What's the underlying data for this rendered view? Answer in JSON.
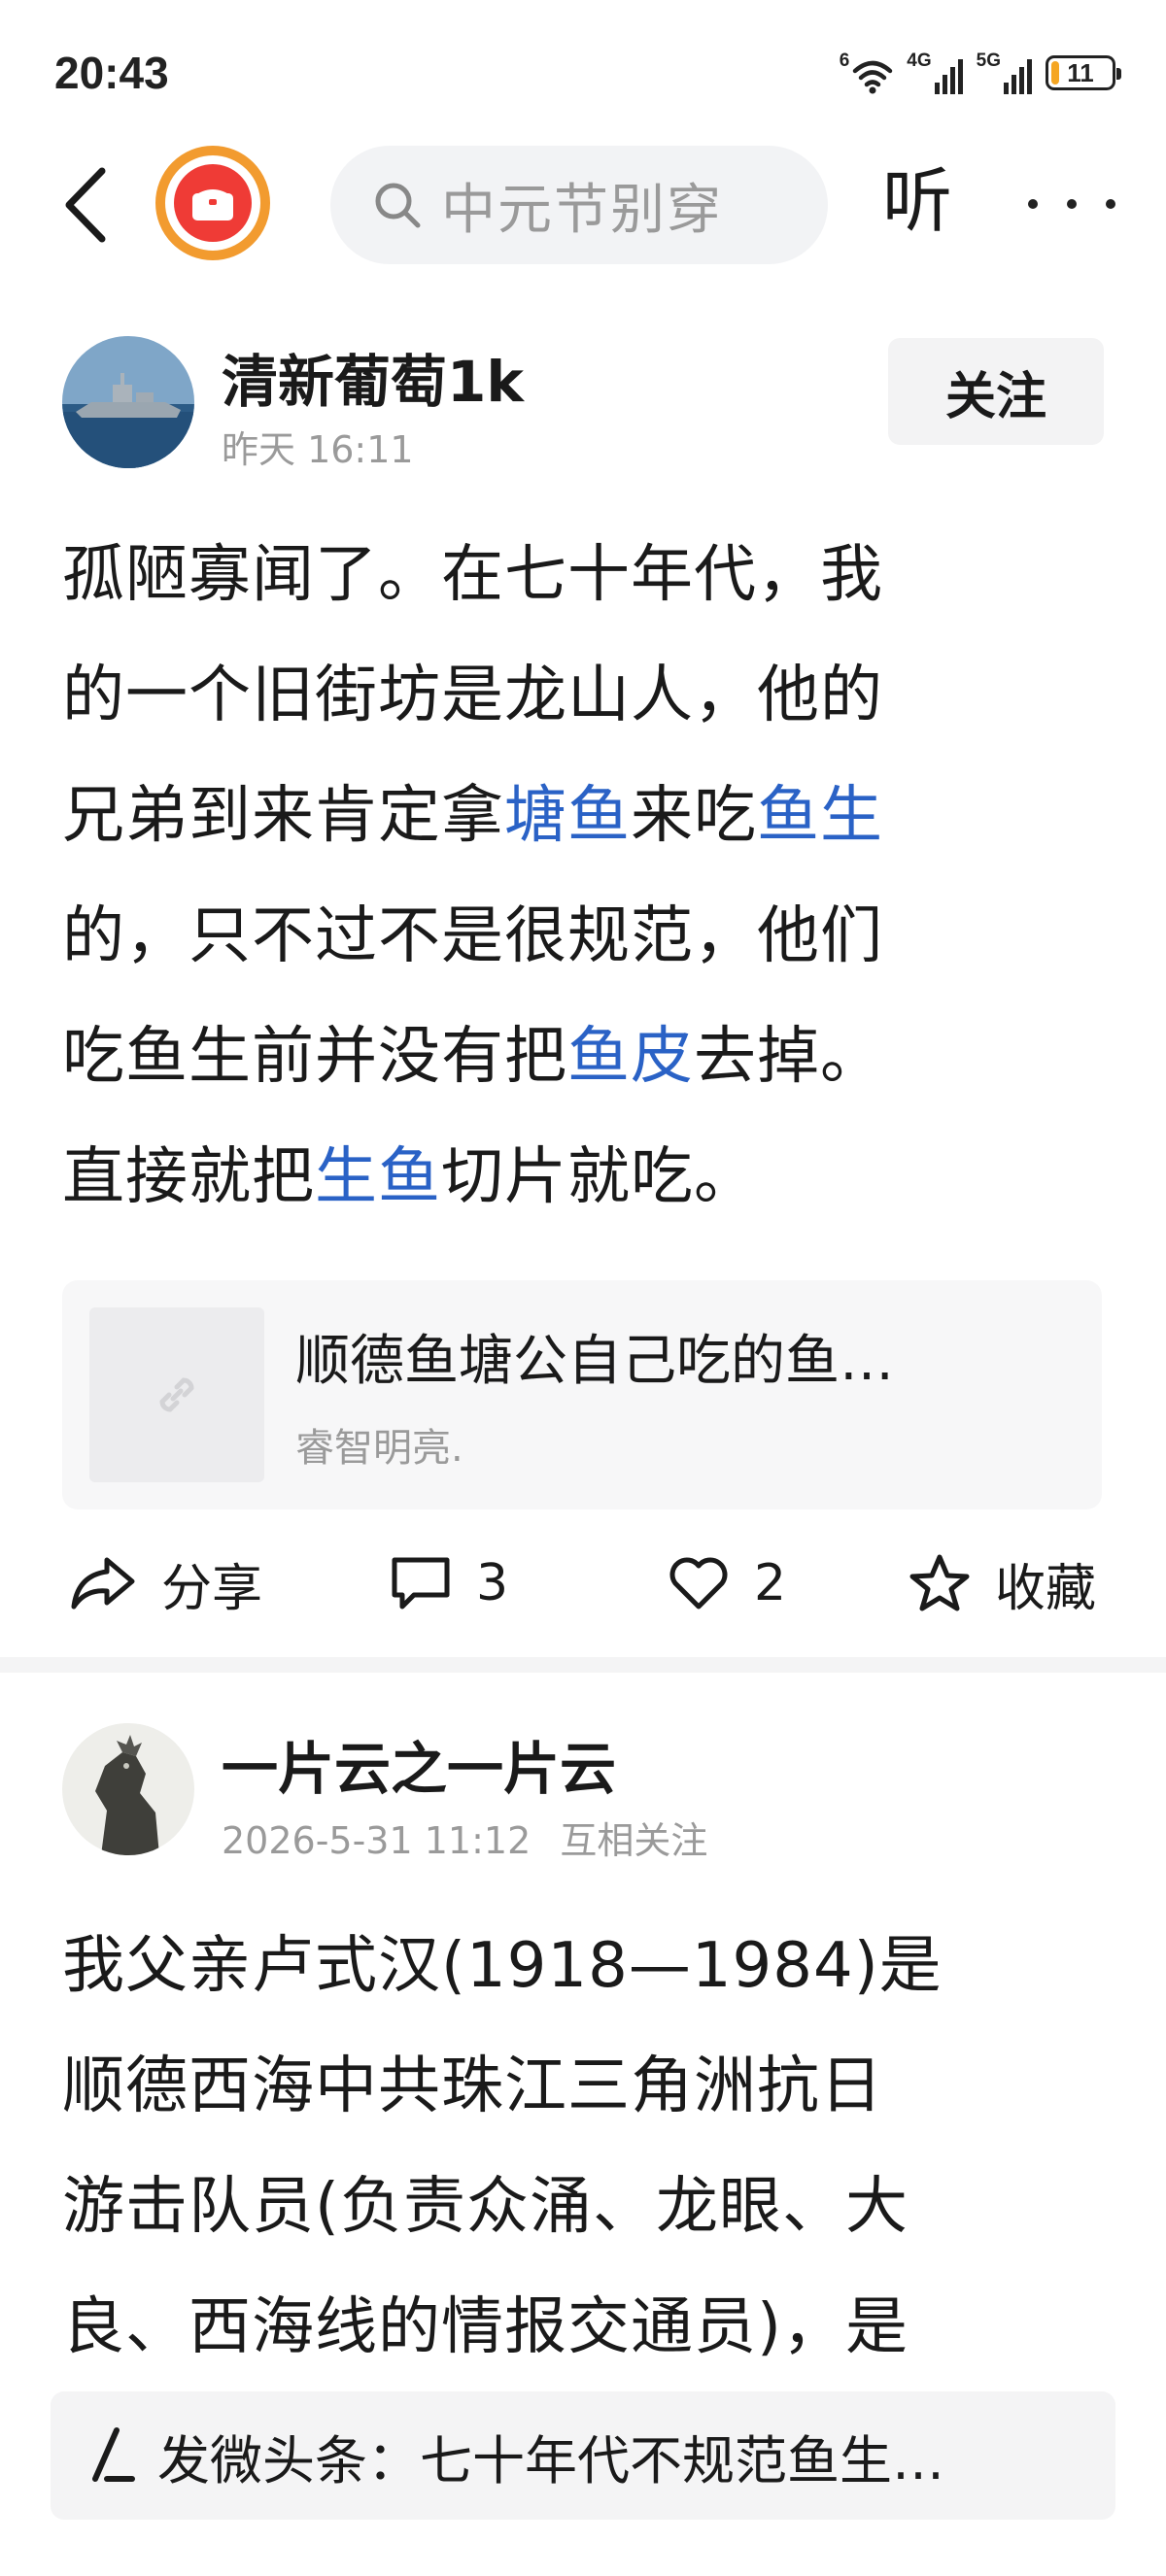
{
  "status_bar": {
    "time": "20:43",
    "network_1": "6",
    "network_2": "4G",
    "network_3": "5G",
    "battery": "11",
    "battery_level_percent": 11,
    "battery_color": "#f5a623"
  },
  "nav": {
    "back_icon": "chevron-left-icon",
    "logo_icon": "toutiao-app-logo",
    "search_placeholder": "中元节别穿",
    "listen_label": "听",
    "more_icon": "more-dots-icon"
  },
  "posts": [
    {
      "author": "清新葡萄1k",
      "meta": "昨天  16:11",
      "follow_label": "关注",
      "body_lines": [
        [
          {
            "t": "孤陋寡闻了。在七十年代，我"
          }
        ],
        [
          {
            "t": "的一个旧街坊是龙山人，他的"
          }
        ],
        [
          {
            "t": "兄弟到来肯定拿"
          },
          {
            "t": "塘鱼",
            "kw": true
          },
          {
            "t": "来吃"
          },
          {
            "t": "鱼生",
            "kw": true
          }
        ],
        [
          {
            "t": "的，只不过不是很规范，他们"
          }
        ],
        [
          {
            "t": "吃鱼生前并没有把"
          },
          {
            "t": "鱼皮",
            "kw": true
          },
          {
            "t": "去掉。"
          }
        ],
        [
          {
            "t": "直接就把"
          },
          {
            "t": "生鱼",
            "kw": true
          },
          {
            "t": "切片就吃。"
          }
        ]
      ],
      "link_card": {
        "title": "顺德鱼塘公自己吃的鱼…",
        "subtitle": "睿智明亮."
      },
      "actions": {
        "share_label": "分享",
        "comment_count": "3",
        "like_count": "2",
        "favorite_label": "收藏"
      }
    },
    {
      "author": "一片云之一片云",
      "meta": "2026-5-31 11:12",
      "relation": "互相关注",
      "body_lines": [
        [
          {
            "t": "我父亲卢式汉(1918—1984)是"
          }
        ],
        [
          {
            "t": "顺德西海中共珠江三角洲抗日"
          }
        ],
        [
          {
            "t": "游击队员(负责众涌、龙眼、大"
          }
        ],
        [
          {
            "t": "良、西海线的情报交通员)，是"
          }
        ]
      ]
    }
  ],
  "bottom_bar": {
    "compose_text": "发微头条：七十年代不规范鱼生…"
  },
  "colors": {
    "keyword_link": "#2a62c6",
    "meta_gray": "#9a9a9a",
    "logo_ring": "#f29b2f",
    "logo_red": "#ef3b36"
  }
}
